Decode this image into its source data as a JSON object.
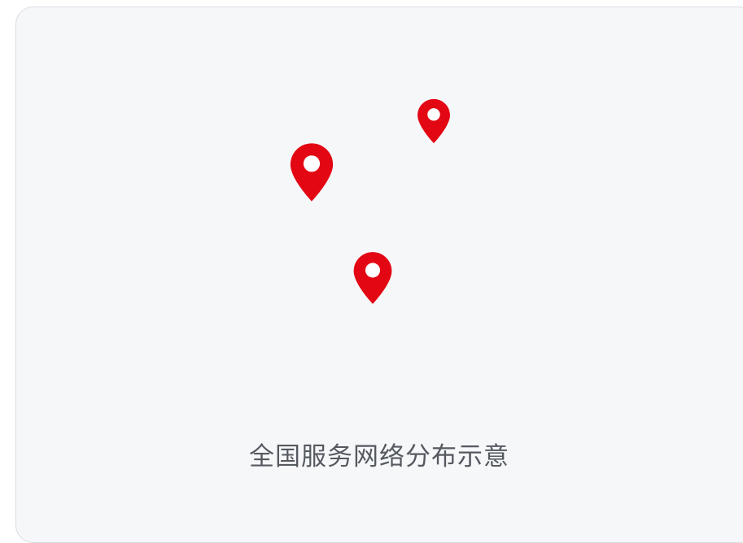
{
  "card": {
    "background": "#f6f7f9",
    "border_color": "#d9dce2"
  },
  "pins": [
    {
      "name": "map-pin-icon",
      "color": "#e30613"
    },
    {
      "name": "map-pin-icon",
      "color": "#e30613"
    },
    {
      "name": "map-pin-icon",
      "color": "#e30613"
    }
  ],
  "caption": "全国服务网络分布示意"
}
